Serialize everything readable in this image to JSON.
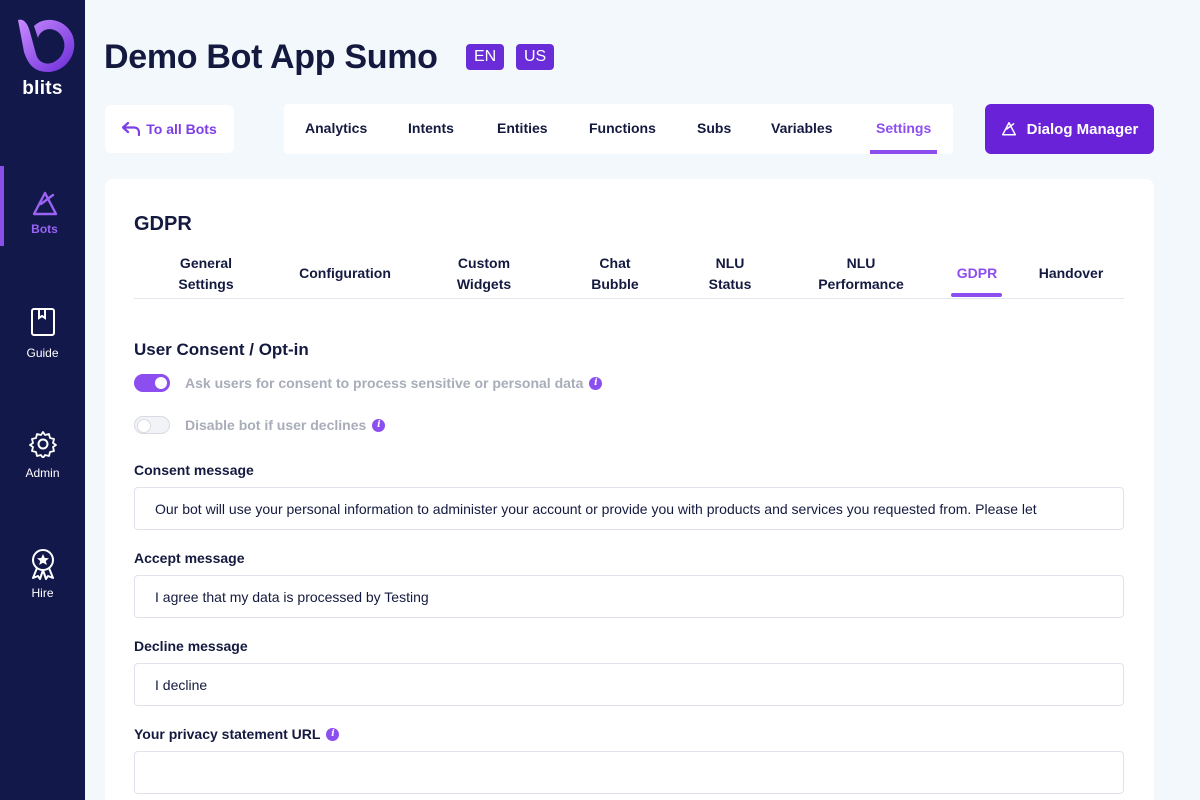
{
  "sidebar": {
    "logo_text": "blits",
    "items": [
      {
        "label": "Bots",
        "icon": "bots-triangle-icon",
        "active": true
      },
      {
        "label": "Guide",
        "icon": "book-icon",
        "active": false
      },
      {
        "label": "Admin",
        "icon": "gear-icon",
        "active": false
      },
      {
        "label": "Hire",
        "icon": "award-icon",
        "active": false
      }
    ]
  },
  "header": {
    "title": "Demo Bot App Sumo",
    "badges": [
      "EN",
      "US"
    ],
    "back_label": "To all Bots",
    "tabs": [
      {
        "label": "Analytics"
      },
      {
        "label": "Intents"
      },
      {
        "label": "Entities"
      },
      {
        "label": "Functions"
      },
      {
        "label": "Subs"
      },
      {
        "label": "Variables"
      },
      {
        "label": "Settings",
        "active": true
      }
    ],
    "dialog_manager_label": "Dialog Manager"
  },
  "card": {
    "title": "GDPR",
    "sub_tabs": [
      {
        "label": "General\nSettings"
      },
      {
        "label": "Configuration"
      },
      {
        "label": "Custom\nWidgets"
      },
      {
        "label": "Chat\nBubble"
      },
      {
        "label": "NLU\nStatus"
      },
      {
        "label": "NLU\nPerformance"
      },
      {
        "label": "GDPR",
        "active": true
      },
      {
        "label": "Handover"
      }
    ],
    "section_title": "User Consent / Opt-in",
    "toggles": [
      {
        "label": "Ask users for consent to process sensitive or personal data",
        "on": true
      },
      {
        "label": "Disable bot if user declines",
        "on": false
      }
    ],
    "fields": [
      {
        "label": "Consent message",
        "value": "Our bot will use your personal information to administer your account or provide you with products and services you requested from. Please let",
        "info": false
      },
      {
        "label": "Accept message",
        "value": "I agree that my data is processed by Testing",
        "info": false
      },
      {
        "label": "Decline message",
        "value": "I decline",
        "info": false
      },
      {
        "label": "Your privacy statement URL",
        "value": "",
        "info": true
      }
    ]
  },
  "colors": {
    "sidebar_bg": "#13184a",
    "accent": "#8d4ef0",
    "primary_button": "#6a22d9",
    "badge": "#6a2bd8",
    "page_bg": "#f3f8fc"
  }
}
